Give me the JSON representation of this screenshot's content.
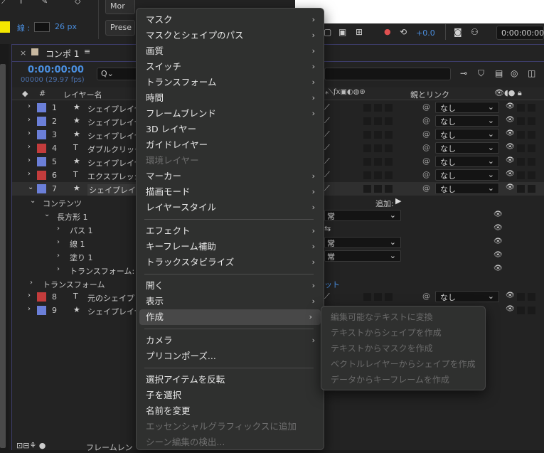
{
  "toolbar": {
    "stroke_label": "線 :",
    "stroke_px": "26 px",
    "preset_label": "Prese",
    "mode_label": "Mor",
    "plus_value": "+0.0",
    "timecode": "0:00:00:00"
  },
  "comp": {
    "tab_label": "コンポ 1",
    "time": "0:00:00:00",
    "fps": "00000 (29.97 fps)",
    "search_placeholder": "Q⌄"
  },
  "columns": {
    "hash": "#",
    "layer_name": "レイヤー名",
    "parent": "親とリンク"
  },
  "layers": [
    {
      "num": "1",
      "type": "★",
      "name": "シェイプレイヤー",
      "color": "#6b7fd8",
      "parent": "なし"
    },
    {
      "num": "2",
      "type": "★",
      "name": "シェイプレイヤー",
      "color": "#6b7fd8",
      "parent": "なし"
    },
    {
      "num": "3",
      "type": "★",
      "name": "シェイプレイヤー",
      "color": "#6b7fd8",
      "parent": "なし"
    },
    {
      "num": "4",
      "type": "T",
      "name": "ダブルクリック...f",
      "color": "#c33c3c",
      "parent": "なし"
    },
    {
      "num": "5",
      "type": "★",
      "name": "シェイプレイヤー",
      "color": "#6b7fd8",
      "parent": "なし"
    },
    {
      "num": "6",
      "type": "T",
      "name": "エクスプレッシ...C",
      "color": "#c33c3c",
      "parent": "なし"
    },
    {
      "num": "7",
      "type": "★",
      "name": "シェイプレイヤー",
      "color": "#6b7fd8",
      "parent": "なし"
    },
    {
      "num": "8",
      "type": "T",
      "name": "元のシェイプレイヤ",
      "color": "#c33c3c",
      "parent": "なし"
    },
    {
      "num": "9",
      "type": "★",
      "name": "シェイプレイヤー",
      "color": "#6b7fd8",
      "parent": ""
    }
  ],
  "props": {
    "contents": "コンテンツ",
    "add": "追加:",
    "rect": "長方形 1",
    "path": "パス 1",
    "stroke": "線 1",
    "fill": "塗り 1",
    "transform_rect": "トランスフォーム: 長",
    "transform": "トランスフォーム",
    "mode1": "常",
    "mode2": "常",
    "mode3": "常",
    "reset": "ット",
    "footer": "フレームレン"
  },
  "menu": {
    "items": [
      {
        "label": "マスク",
        "sub": true
      },
      {
        "label": "マスクとシェイプのパス",
        "sub": true
      },
      {
        "label": "画質",
        "sub": true
      },
      {
        "label": "スイッチ",
        "sub": true
      },
      {
        "label": "トランスフォーム",
        "sub": true
      },
      {
        "label": "時間",
        "sub": true
      },
      {
        "label": "フレームブレンド",
        "sub": true
      },
      {
        "label": "3D レイヤー",
        "sub": false
      },
      {
        "label": "ガイドレイヤー",
        "sub": false
      },
      {
        "label": "環境レイヤー",
        "sub": false,
        "disabled": true
      },
      {
        "label": "マーカー",
        "sub": true
      },
      {
        "label": "描画モード",
        "sub": true
      },
      {
        "label": "レイヤースタイル",
        "sub": true
      },
      {
        "label": "エフェクト",
        "sub": true
      },
      {
        "label": "キーフレーム補助",
        "sub": true
      },
      {
        "label": "トラックスタビライズ",
        "sub": true
      },
      {
        "label": "開く",
        "sub": true
      },
      {
        "label": "表示",
        "sub": true
      },
      {
        "label": "作成",
        "sub": true,
        "highlighted": true
      },
      {
        "label": "カメラ",
        "sub": true
      },
      {
        "label": "プリコンポーズ...",
        "sub": false
      },
      {
        "label": "選択アイテムを反転",
        "sub": false
      },
      {
        "label": "子を選択",
        "sub": false
      },
      {
        "label": "名前を変更",
        "sub": false
      },
      {
        "label": "エッセンシャルグラフィックスに追加",
        "sub": false,
        "disabled": true
      },
      {
        "label": "シーン編集の検出...",
        "sub": false,
        "disabled": true
      }
    ]
  },
  "submenu": {
    "items": [
      "編集可能なテキストに変換",
      "テキストからシェイプを作成",
      "テキストからマスクを作成",
      "ベクトルレイヤーからシェイプを作成",
      "データからキーフレームを作成"
    ]
  },
  "colors": {
    "yellow_swatch": "#f5e800",
    "blue_label": "#6b7fd8",
    "red_label": "#c33c3c",
    "time_blue": "#4a8fe0"
  }
}
